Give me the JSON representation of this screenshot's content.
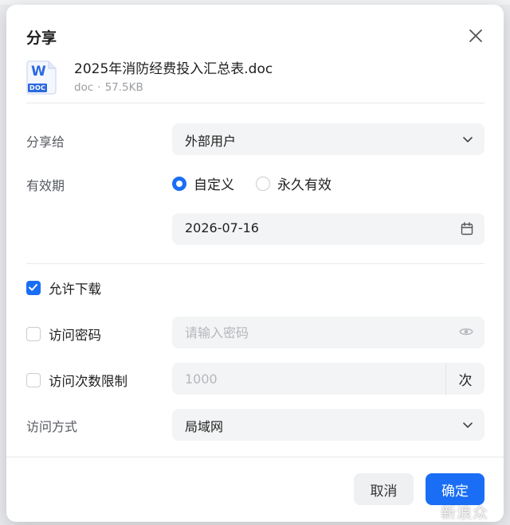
{
  "dialog": {
    "title": "分享"
  },
  "file": {
    "icon_letter": "W",
    "icon_tag": "DOC",
    "name": "2025年消防经费投入汇总表.doc",
    "type": "doc",
    "size": "57.5KB"
  },
  "share_to": {
    "label": "分享给",
    "value": "外部用户"
  },
  "validity": {
    "label": "有效期",
    "options": [
      "自定义",
      "永久有效"
    ],
    "selected": "自定义",
    "date": "2026-07-16"
  },
  "allow_download": {
    "label": "允许下载",
    "checked": true
  },
  "access_password": {
    "label": "访问密码",
    "checked": false,
    "placeholder": "请输入密码"
  },
  "access_limit": {
    "label": "访问次数限制",
    "checked": false,
    "placeholder": "1000",
    "suffix": "次"
  },
  "access_method": {
    "label": "访问方式",
    "value": "局域网"
  },
  "footer": {
    "cancel_label": "取消",
    "ok_label": "确定"
  },
  "watermark": "新浪众测",
  "colors": {
    "accent": "#1a6ef5",
    "field_bg": "#f3f4f5",
    "doc_blue": "#2b6ae0"
  },
  "icons": [
    "close-icon",
    "word-doc-icon",
    "chevron-down-icon",
    "calendar-icon",
    "eye-icon",
    "check-icon"
  ]
}
